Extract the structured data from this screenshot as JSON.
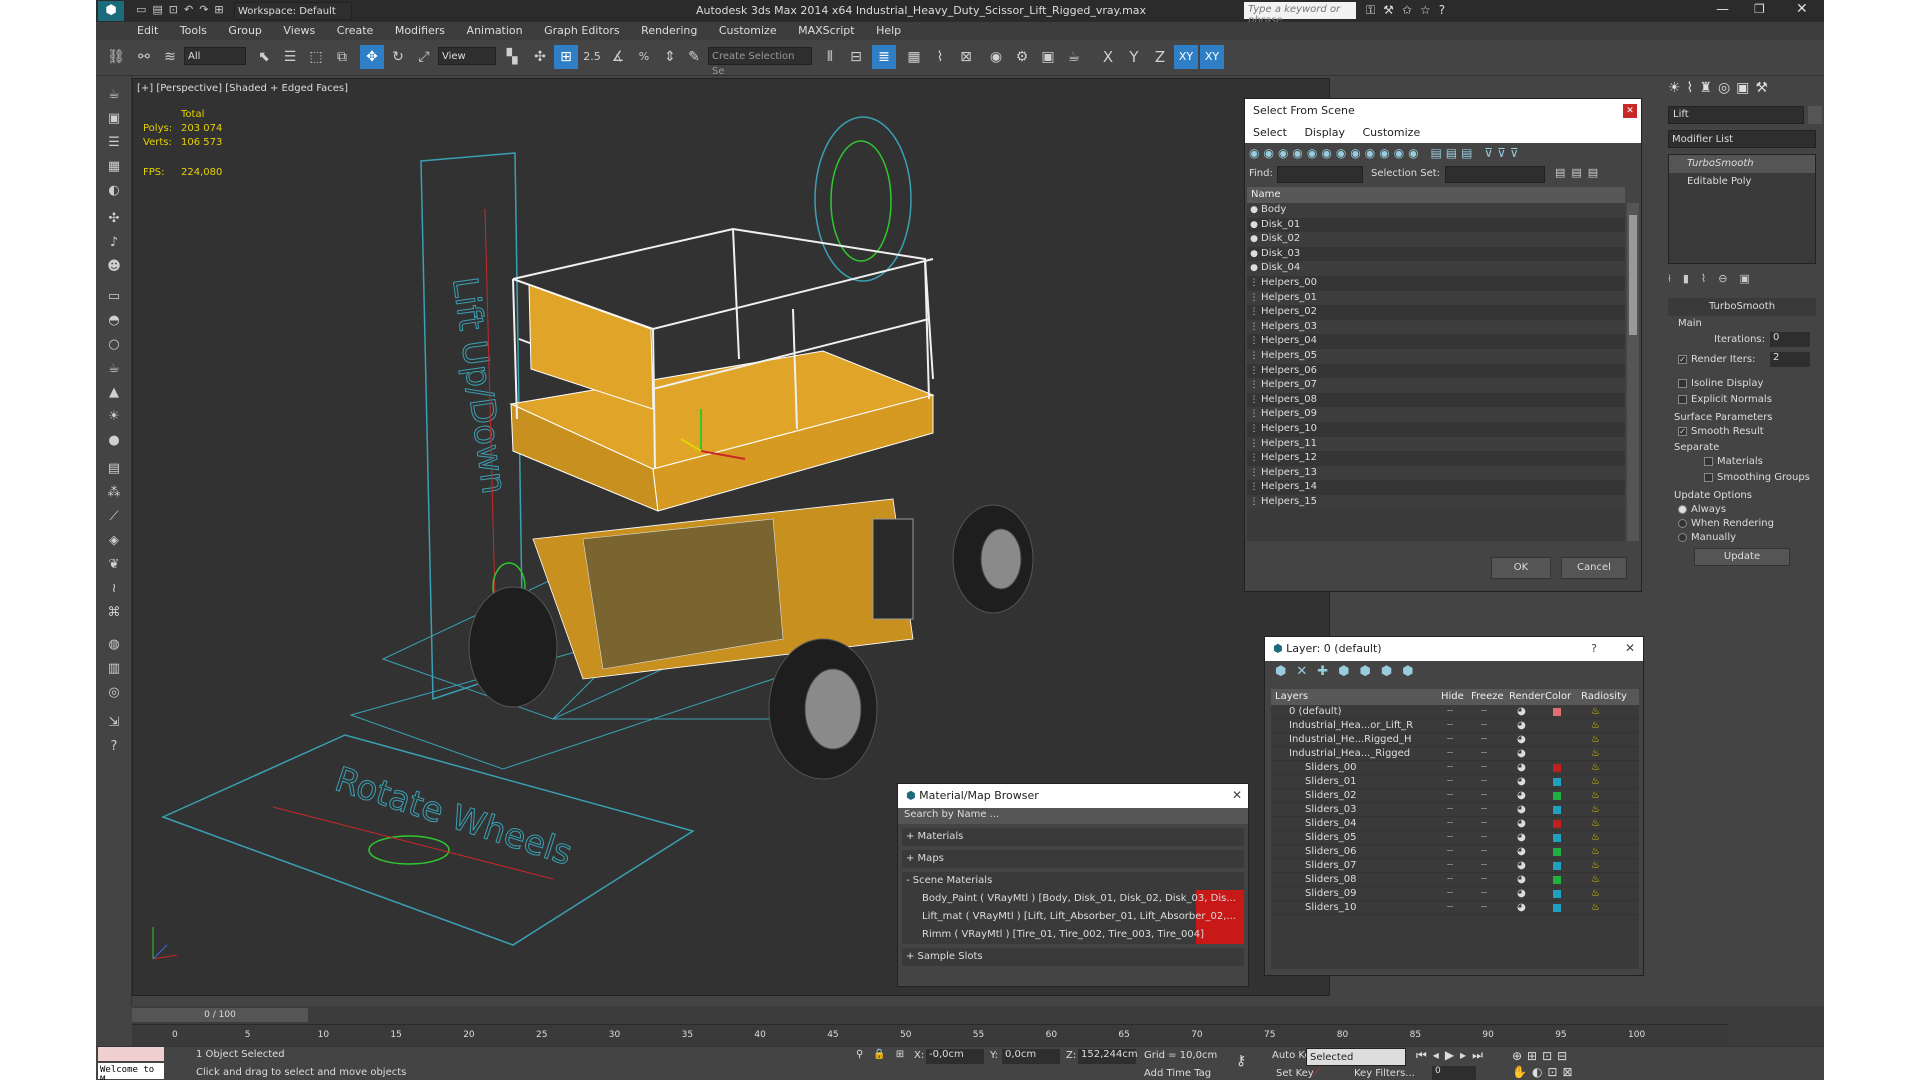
{
  "app": {
    "workspace": "Workspace: Default",
    "title": "Autodesk 3ds Max  2014 x64     Industrial_Heavy_Duty_Scissor_Lift_Rigged_vray.max",
    "search_placeholder": "Type a keyword or phrase"
  },
  "menu": [
    "Edit",
    "Tools",
    "Group",
    "Views",
    "Create",
    "Modifiers",
    "Animation",
    "Graph Editors",
    "Rendering",
    "Customize",
    "MAXScript",
    "Help"
  ],
  "toolbar": {
    "selection_filter": "All",
    "ref_coord": "View",
    "snap_label": "2.5",
    "selection_set_placeholder": "Create Selection Se",
    "axis_x": "X",
    "axis_y": "Y",
    "axis_z": "Z",
    "axis_xy": "XY",
    "axis_xy2": "XY"
  },
  "viewport": {
    "label": "[+] [Perspective] [Shaded + Edged Faces]",
    "stats_total": "Total",
    "polys_label": "Polys:",
    "polys_value": "203 074",
    "verts_label": "Verts:",
    "verts_value": "106 573",
    "fps_label": "FPS:",
    "fps_value": "224,080",
    "text_lift": "Lift Up/Down",
    "text_rotate": "Rotate Wheels",
    "colors": {
      "model": "#e0a528",
      "wire": "#ffffff",
      "helper": "#3aa0b4",
      "green": "#2fc82f",
      "red": "#c82828",
      "bg": "#323232"
    }
  },
  "select_from_scene": {
    "title": "Select From Scene",
    "menu": [
      "Select",
      "Display",
      "Customize"
    ],
    "find_label": "Find:",
    "selection_set_label": "Selection Set:",
    "column_name": "Name",
    "items": [
      "Body",
      "Disk_01",
      "Disk_02",
      "Disk_03",
      "Disk_04",
      "Helpers_00",
      "Helpers_01",
      "Helpers_02",
      "Helpers_03",
      "Helpers_04",
      "Helpers_05",
      "Helpers_06",
      "Helpers_07",
      "Helpers_08",
      "Helpers_09",
      "Helpers_10",
      "Helpers_11",
      "Helpers_12",
      "Helpers_13",
      "Helpers_14",
      "Helpers_15"
    ],
    "ok": "OK",
    "cancel": "Cancel"
  },
  "layer_dialog": {
    "title": "Layer: 0 (default)",
    "help": "?",
    "columns": {
      "layers": "Layers",
      "hide": "Hide",
      "freeze": "Freeze",
      "render": "Render",
      "color": "Color",
      "radiosity": "Radiosity"
    },
    "rows": [
      {
        "name": "0 (default)",
        "color": "#e07070",
        "indent": 0
      },
      {
        "name": "Industrial_Hea...or_Lift_R",
        "color": "#3a3a3a",
        "indent": 0
      },
      {
        "name": "Industrial_He...Rigged_H",
        "color": "#3a3a3a",
        "indent": 0
      },
      {
        "name": "Industrial_Hea..._Rigged",
        "color": "#3a3a3a",
        "indent": 0
      },
      {
        "name": "Sliders_00",
        "color": "#c02020",
        "indent": 1
      },
      {
        "name": "Sliders_01",
        "color": "#20a0c0",
        "indent": 1
      },
      {
        "name": "Sliders_02",
        "color": "#20b040",
        "indent": 1
      },
      {
        "name": "Sliders_03",
        "color": "#20a0c0",
        "indent": 1
      },
      {
        "name": "Sliders_04",
        "color": "#c02020",
        "indent": 1
      },
      {
        "name": "Sliders_05",
        "color": "#20a0c0",
        "indent": 1
      },
      {
        "name": "Sliders_06",
        "color": "#20b040",
        "indent": 1
      },
      {
        "name": "Sliders_07",
        "color": "#20a0c0",
        "indent": 1
      },
      {
        "name": "Sliders_08",
        "color": "#20b040",
        "indent": 1
      },
      {
        "name": "Sliders_09",
        "color": "#20a0c0",
        "indent": 1
      },
      {
        "name": "Sliders_10",
        "color": "#20a0c0",
        "indent": 1
      }
    ]
  },
  "material_browser": {
    "title": "Material/Map Browser",
    "search_placeholder": "Search by Name ...",
    "sections": {
      "materials": "+ Materials",
      "maps": "+ Maps",
      "scene": "- Scene Materials",
      "sample": "+ Sample Slots"
    },
    "scene_materials": [
      "Body_Paint  ( VRayMtl ) [Body, Disk_01, Disk_02, Disk_03, Dis...",
      "Lift_mat  ( VRayMtl ) [Lift, Lift_Absorber_01, Lift_Absorber_02,...",
      "Rimm  ( VRayMtl ) [Tire_01, Tire_002, Tire_003, Tire_004]"
    ]
  },
  "command_panel": {
    "object_name": "Lift",
    "modifier_list": "Modifier List",
    "stack": [
      "TurboSmooth",
      "Editable Poly"
    ],
    "rollout_title": "TurboSmooth",
    "main_label": "Main",
    "iterations_label": "Iterations:",
    "iterations_value": "0",
    "render_iters_label": "Render Iters:",
    "render_iters_value": "2",
    "isoline": "Isoline Display",
    "explicit_normals": "Explicit Normals",
    "surface_params": "Surface Parameters",
    "smooth_result": "Smooth Result",
    "separate": "Separate",
    "materials": "Materials",
    "smoothing_groups": "Smoothing Groups",
    "update_options": "Update Options",
    "always": "Always",
    "when_rendering": "When Rendering",
    "manually": "Manually",
    "update_btn": "Update"
  },
  "timeline": {
    "frame_label": "0 / 100",
    "ticks": [
      "0",
      "5",
      "10",
      "15",
      "20",
      "25",
      "30",
      "35",
      "40",
      "45",
      "50",
      "55",
      "60",
      "65",
      "70",
      "75",
      "80",
      "85",
      "90",
      "95",
      "100"
    ]
  },
  "status": {
    "selected": "1 Object Selected",
    "prompt": "Click and drag to select and move objects",
    "welcome": "Welcome to M",
    "x_label": "X:",
    "x_value": "-0,0cm",
    "y_label": "Y:",
    "y_value": "0,0cm",
    "z_label": "Z:",
    "z_value": "152,244cm",
    "grid": "Grid = 10,0cm",
    "auto_key": "Auto Key",
    "selected_dd": "Selected",
    "set_key": "Set Key",
    "key_filters": "Key Filters...",
    "add_time_tag": "Add Time Tag",
    "frame_value": "0"
  }
}
